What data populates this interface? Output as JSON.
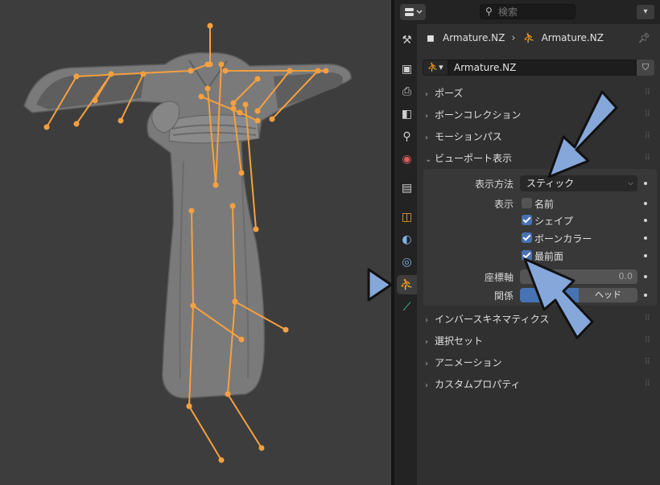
{
  "search": {
    "placeholder": "検索"
  },
  "breadcrumb": {
    "object_name": "Armature.NZ",
    "data_name": "Armature.NZ"
  },
  "datablock": {
    "name": "Armature.NZ"
  },
  "tabs": [
    {
      "name": "tool-icon",
      "glyph": "⚒",
      "color": "#cfcfcf"
    },
    {
      "name": "render-icon",
      "glyph": "▣",
      "color": "#cfcfcf"
    },
    {
      "name": "output-icon",
      "glyph": "⎙",
      "color": "#cfcfcf"
    },
    {
      "name": "view-layer-icon",
      "glyph": "◧",
      "color": "#cfcfcf"
    },
    {
      "name": "scene-icon",
      "glyph": "⚲",
      "color": "#cfcfcf"
    },
    {
      "name": "world-icon",
      "glyph": "◉",
      "color": "#e05a5a"
    },
    {
      "name": "collection-icon",
      "glyph": "▤",
      "color": "#cfcfcf"
    },
    {
      "name": "object-icon",
      "glyph": "◫",
      "color": "#f5a042"
    },
    {
      "name": "modifier-icon",
      "glyph": "◐",
      "color": "#7fb4e8"
    },
    {
      "name": "physics-icon",
      "glyph": "◎",
      "color": "#7fb4e8"
    },
    {
      "name": "armature-data-icon",
      "glyph": "⛹",
      "color": "#4fd1a0"
    },
    {
      "name": "bone-icon",
      "glyph": "⟋",
      "color": "#4fd1a0"
    }
  ],
  "panels": {
    "pose": "ポーズ",
    "bone_collections": "ボーンコレクション",
    "motion_paths": "モーションパス",
    "viewport_display": "ビューポート表示",
    "inverse_kinematics": "インバースキネマティクス",
    "selection_sets": "選択セット",
    "animation": "アニメーション",
    "custom_properties": "カスタムプロパティ"
  },
  "viewport_display": {
    "display_as_label": "表示方法",
    "display_as_value": "スティック",
    "show_label": "表示",
    "names_label": "名前",
    "names_checked": false,
    "shapes_label": "シェイプ",
    "shapes_checked": true,
    "bone_colors_label": "ボーンカラー",
    "bone_colors_checked": true,
    "in_front_label": "最前面",
    "in_front_checked": true,
    "axes_label": "座標軸",
    "axes_value": "0.0",
    "relation_label": "関係",
    "relation_right": "ヘッド"
  },
  "colors": {
    "bone": "#f5a040",
    "callout": "#86a7d9",
    "accent": "#4772b3"
  }
}
